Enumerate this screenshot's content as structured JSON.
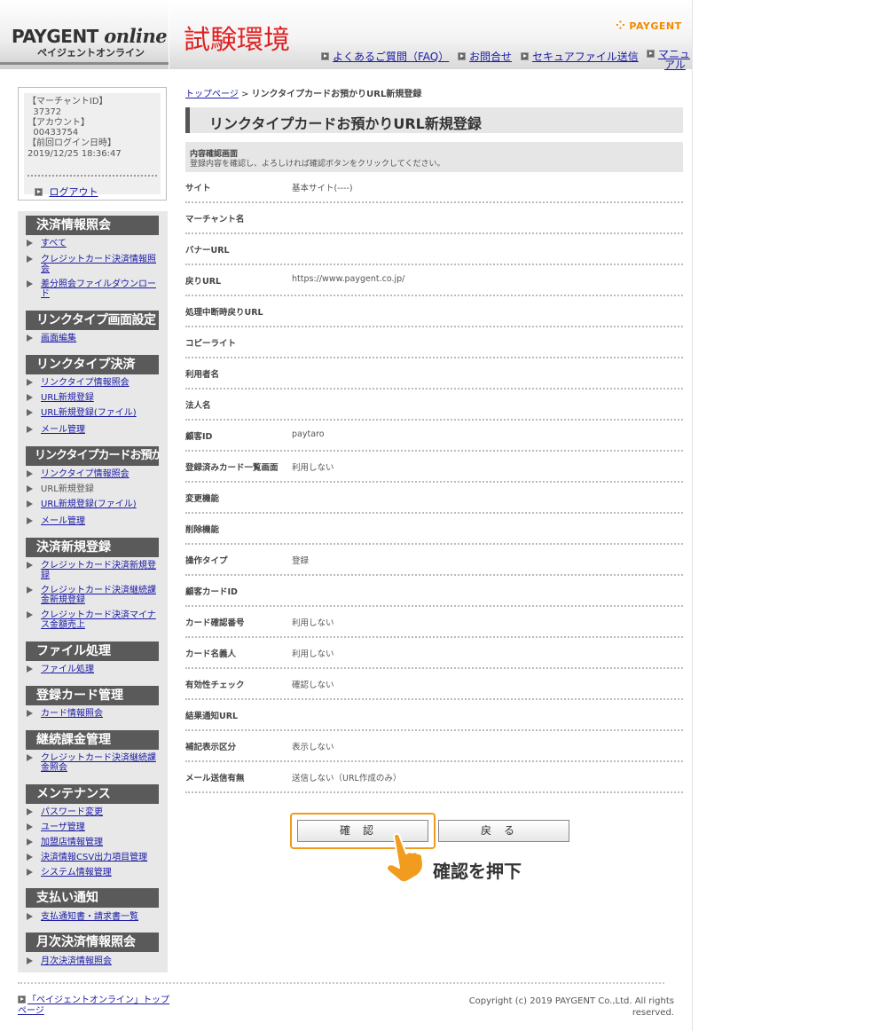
{
  "header": {
    "logo_main_a": "PAYGENT ",
    "logo_main_b": "online",
    "logo_sub": "ペイジェントオンライン",
    "env_title": "試験環境",
    "brand": "PAYGENT",
    "nav": [
      {
        "label": "よくあるご質問（FAQ）"
      },
      {
        "label": "お問合せ"
      },
      {
        "label": "セキュアファイル送信"
      },
      {
        "label_1": "マニュ",
        "label_2": "アル"
      }
    ]
  },
  "account": {
    "merchant_id_label": "【マーチャントID】",
    "merchant_id": "37372",
    "account_label": "【アカウント】",
    "account": "00433754",
    "last_login_label": "【前回ログイン日時】",
    "last_login": "2019/12/25 18:36:47",
    "logout": "ログアウト"
  },
  "menu": [
    {
      "heading": "決済情報照会",
      "items": [
        {
          "label": "すべて"
        },
        {
          "label": "クレジットカード決済情報照会"
        },
        {
          "label": "差分照会ファイルダウンロード"
        }
      ]
    },
    {
      "heading": "リンクタイプ画面設定",
      "items": [
        {
          "label": "画面編集"
        }
      ]
    },
    {
      "heading": "リンクタイプ決済",
      "items": [
        {
          "label": "リンクタイプ情報照会"
        },
        {
          "label": "URL新規登録"
        },
        {
          "label": "URL新規登録(ファイル)"
        },
        {
          "label": "メール管理"
        }
      ]
    },
    {
      "heading": "リンクタイプカードお預かり",
      "items": [
        {
          "label": "リンクタイプ情報照会"
        },
        {
          "label": "URL新規登録"
        },
        {
          "label": "URL新規登録(ファイル)"
        },
        {
          "label": "メール管理"
        }
      ]
    },
    {
      "heading": "決済新規登録",
      "items": [
        {
          "label": "クレジットカード決済新規登録"
        },
        {
          "label": "クレジットカード決済継続課金新規登録"
        },
        {
          "label": "クレジットカード決済マイナス金額売上"
        }
      ]
    },
    {
      "heading": "ファイル処理",
      "items": [
        {
          "label": "ファイル処理"
        }
      ]
    },
    {
      "heading": "登録カード管理",
      "items": [
        {
          "label": "カード情報照会"
        }
      ]
    },
    {
      "heading": "継続課金管理",
      "items": [
        {
          "label": "クレジットカード決済継続課金照会"
        }
      ]
    },
    {
      "heading": "メンテナンス",
      "items": [
        {
          "label": "パスワード変更"
        },
        {
          "label": "ユーザ管理"
        },
        {
          "label": "加盟店情報管理"
        },
        {
          "label": "決済情報CSV出力項目管理"
        },
        {
          "label": "システム情報管理"
        }
      ]
    },
    {
      "heading": "支払い通知",
      "items": [
        {
          "label": "支払通知書・請求書一覧"
        }
      ]
    },
    {
      "heading": "月次決済情報照会",
      "items": [
        {
          "label": "月次決済情報照会"
        }
      ]
    }
  ],
  "breadcrumb": {
    "home": "トップページ",
    "separator": " > ",
    "current": "リンクタイプカードお預かりURL新規登録"
  },
  "page_title": "リンクタイプカードお預かりURL新規登録",
  "confirm": {
    "heading": "内容確認画面",
    "description": "登録内容を確認し、よろしければ確認ボタンをクリックしてください。"
  },
  "rows": [
    {
      "label": "サイト",
      "value": "基本サイト(----)"
    },
    {
      "label": "マーチャント名",
      "value": ""
    },
    {
      "label": "バナーURL",
      "value": ""
    },
    {
      "label": "戻りURL",
      "value": "https://www.paygent.co.jp/"
    },
    {
      "label": "処理中断時戻りURL",
      "value": ""
    },
    {
      "label": "コピーライト",
      "value": ""
    },
    {
      "label": "利用者名",
      "value": ""
    },
    {
      "label": "法人名",
      "value": ""
    },
    {
      "label": "顧客ID",
      "value": "paytaro"
    },
    {
      "label": "登録済みカード一覧画面",
      "value": "利用しない"
    },
    {
      "label": "変更機能",
      "value": ""
    },
    {
      "label": "削除機能",
      "value": ""
    },
    {
      "label": "操作タイプ",
      "value": "登録"
    },
    {
      "label": "顧客カードID",
      "value": ""
    },
    {
      "label": "カード確認番号",
      "value": "利用しない"
    },
    {
      "label": "カード名義人",
      "value": "利用しない"
    },
    {
      "label": "有効性チェック",
      "value": "確認しない"
    },
    {
      "label": "結果通知URL",
      "value": ""
    },
    {
      "label": "補記表示区分",
      "value": "表示しない"
    },
    {
      "label": "メール送信有無",
      "value": "送信しない（URL作成のみ）"
    }
  ],
  "buttons": {
    "confirm": "確認",
    "back": "戻る"
  },
  "annotation": {
    "press_label": "確認を押下"
  },
  "footer": {
    "top_link_1": "「ペイジェントオンライン」トップ",
    "top_link_2": "ページ",
    "copyright_1": "Copyright (c) 2019 PAYGENT Co.,Ltd. All rights",
    "copyright_2": "reserved."
  },
  "colors": {
    "env_title": "#e02020",
    "brand": "#f08a00",
    "menu_heading_bg": "#5a5a5a",
    "highlight": "#f19a1a",
    "link": "#1a1aa6"
  }
}
